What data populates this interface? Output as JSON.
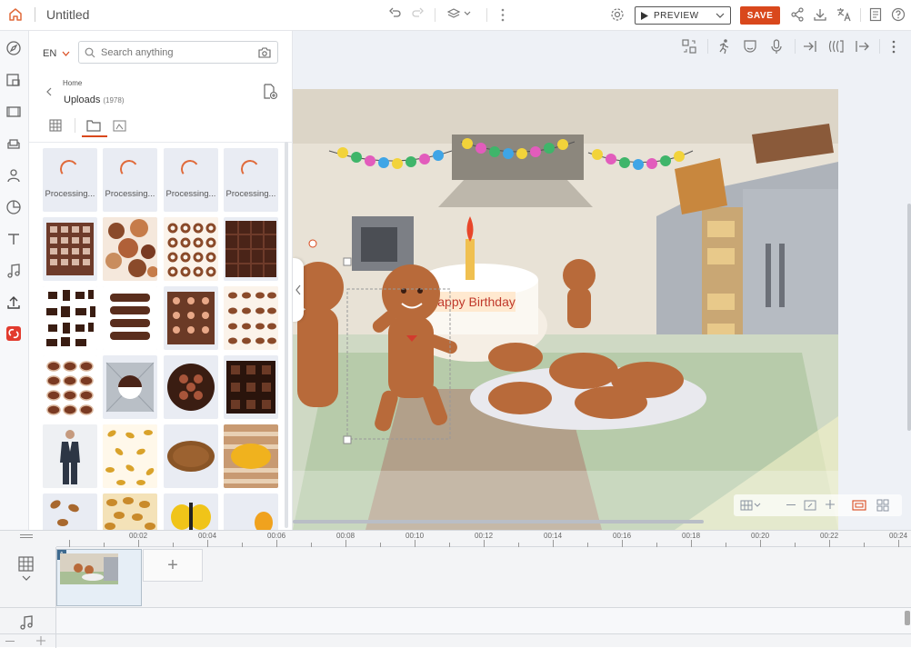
{
  "app": {
    "title": "Untitled"
  },
  "toolbar": {
    "preview_label": "PREVIEW",
    "save_label": "SAVE"
  },
  "panel": {
    "language": "EN",
    "search_placeholder": "Search anything",
    "breadcrumb_home": "Home",
    "folder_title": "Uploads",
    "folder_count": "(1978)",
    "processing_label": "Processing..."
  },
  "canvas": {
    "cake_text": "Happy Birthday"
  },
  "timeline": {
    "ticks": [
      "00:02",
      "00:04",
      "00:06",
      "00:08",
      "00:10",
      "00:12",
      "00:14",
      "00:16",
      "00:18",
      "00:20",
      "00:22",
      "00:24"
    ],
    "scene_number": "1",
    "add_scene": "+"
  },
  "colors": {
    "accent": "#d9481c",
    "spinner": "#e06a3a"
  }
}
